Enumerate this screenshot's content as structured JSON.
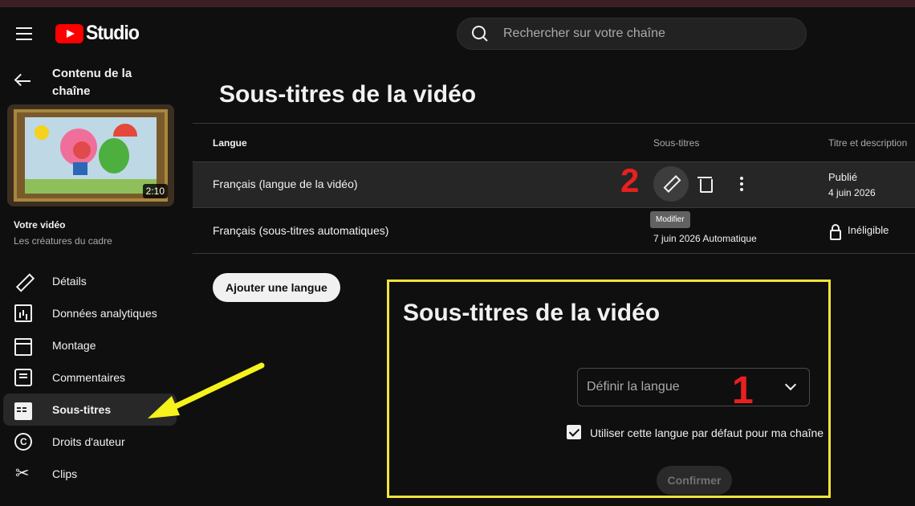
{
  "header": {
    "logo_text": "Studio",
    "search_placeholder": "Rechercher sur votre chaîne"
  },
  "sidebar": {
    "channel_title": "Contenu de la chaîne",
    "video_duration": "2:10",
    "video_label": "Votre vidéo",
    "video_name": "Les créatures du cadre",
    "items": [
      {
        "label": "Détails",
        "icon": "pencil-icon"
      },
      {
        "label": "Données analytiques",
        "icon": "analytics-icon"
      },
      {
        "label": "Montage",
        "icon": "clapperboard-icon"
      },
      {
        "label": "Commentaires",
        "icon": "comment-icon"
      },
      {
        "label": "Sous-titres",
        "icon": "subtitles-icon",
        "active": true
      },
      {
        "label": "Droits d'auteur",
        "icon": "copyright-icon"
      },
      {
        "label": "Clips",
        "icon": "scissors-icon"
      }
    ]
  },
  "main": {
    "title": "Sous-titres de la vidéo",
    "table": {
      "headers": [
        "Langue",
        "Sous-titres",
        "Titre et description"
      ],
      "rows": [
        {
          "language": "Français (langue de la vidéo)",
          "title_status": "Publié",
          "title_date": "4 juin 2026"
        },
        {
          "language": "Français (sous-titres automatiques)",
          "subtitle_info": "7 juin 2026 Automatique",
          "title_status": "Inéligible"
        }
      ]
    },
    "edit_tooltip": "Modifier",
    "add_language": "Ajouter une langue"
  },
  "annotations": {
    "step1": "1",
    "step2": "2",
    "annotation_color": "#e8201f",
    "arrow_color": "#f5f21c",
    "box_color": "#f2e33a"
  },
  "dialog": {
    "title": "Sous-titres de la vidéo",
    "select_placeholder": "Définir la langue",
    "checkbox_label": "Utiliser cette langue par défaut pour ma chaîne",
    "checkbox_checked": true,
    "confirm_label": "Confirmer"
  },
  "colors": {
    "background": "#0f0f0f",
    "youtube_red": "#ff0000",
    "row_highlight": "#262626"
  }
}
